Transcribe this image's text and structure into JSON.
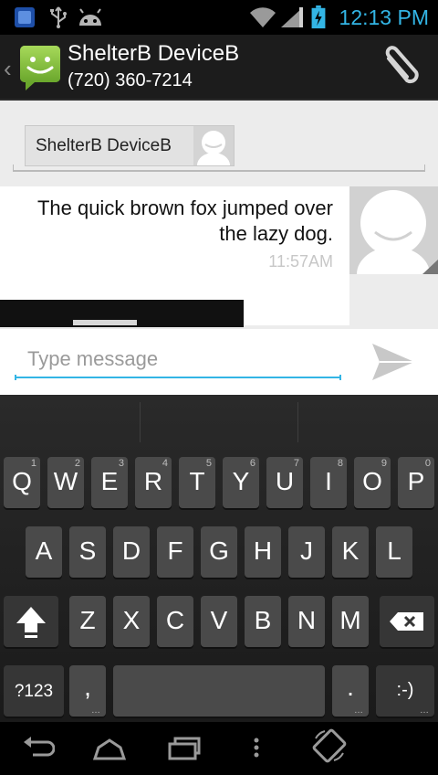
{
  "status_bar": {
    "time": "12:13 PM",
    "icons": [
      "notification-app-icon",
      "usb-icon",
      "android-debug-icon",
      "wifi-icon",
      "signal-icon",
      "battery-charging-icon"
    ],
    "accent_color": "#33b5e5"
  },
  "header": {
    "title": "ShelterB DeviceB",
    "subtitle": "(720) 360-7214",
    "icons": [
      "messaging-app-icon",
      "attach-icon"
    ]
  },
  "recipients": {
    "chip_label": "ShelterB DeviceB"
  },
  "messages": [
    {
      "text": "The quick brown fox jumped over the lazy dog.",
      "time": "11:57AM"
    }
  ],
  "compose": {
    "placeholder": "Type message",
    "value": "",
    "send_icon": "send-icon"
  },
  "keyboard": {
    "rows": [
      [
        {
          "label": "Q",
          "hint": "1"
        },
        {
          "label": "W",
          "hint": "2"
        },
        {
          "label": "E",
          "hint": "3"
        },
        {
          "label": "R",
          "hint": "4"
        },
        {
          "label": "T",
          "hint": "5"
        },
        {
          "label": "Y",
          "hint": "6"
        },
        {
          "label": "U",
          "hint": "7"
        },
        {
          "label": "I",
          "hint": "8"
        },
        {
          "label": "O",
          "hint": "9"
        },
        {
          "label": "P",
          "hint": "0"
        }
      ],
      [
        {
          "label": "A"
        },
        {
          "label": "S"
        },
        {
          "label": "D"
        },
        {
          "label": "F"
        },
        {
          "label": "G"
        },
        {
          "label": "H"
        },
        {
          "label": "J"
        },
        {
          "label": "K"
        },
        {
          "label": "L"
        }
      ],
      [
        {
          "label": "Z"
        },
        {
          "label": "X"
        },
        {
          "label": "C"
        },
        {
          "label": "V"
        },
        {
          "label": "B"
        },
        {
          "label": "N"
        },
        {
          "label": "M"
        }
      ]
    ],
    "symbols_label": "?123",
    "comma_label": ",",
    "period_label": ".",
    "smiley_label": ":-)",
    "shift_icon": "shift-icon",
    "delete_icon": "backspace-icon"
  },
  "nav_bar": {
    "icons": [
      "back-icon",
      "home-icon",
      "recent-apps-icon",
      "menu-icon",
      "rotate-icon"
    ]
  }
}
